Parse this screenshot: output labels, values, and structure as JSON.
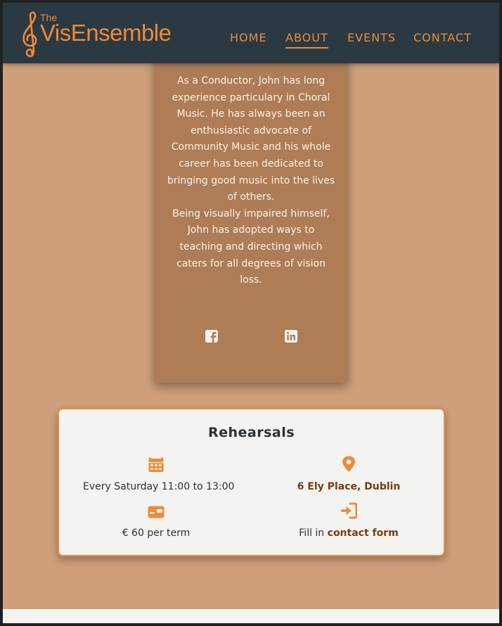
{
  "brand": {
    "the": "The",
    "name_a": "Vis",
    "name_b": "Ensemble",
    "accent_color": "#ee8a3a",
    "icon": "treble-clef-icon"
  },
  "nav": {
    "items": [
      {
        "label": "HOME",
        "active": false
      },
      {
        "label": "ABOUT",
        "active": true
      },
      {
        "label": "EVENTS",
        "active": false
      },
      {
        "label": "CONTACT",
        "active": false
      }
    ]
  },
  "profile": {
    "bio_1": "As a Conductor, John has long experience particulary in Choral Music. He has always been an enthusiastic advocate of Community Music and his whole career has been dedicated to bringing good music into the lives of others.",
    "bio_2": "Being visually impaired himself, John has adopted ways to teaching and directing which caters for all degrees of vision loss.",
    "social": [
      "facebook-icon",
      "linkedin-icon"
    ]
  },
  "rehearsals": {
    "title": "Rehearsals",
    "schedule": "Every Saturday 11:00 to 13:00",
    "location": "6 Ely Place, Dublin",
    "price": "€ 60 per term",
    "signup_prefix": "Fill in ",
    "signup_link": "contact form",
    "icons": [
      "calendar-icon",
      "map-pin-icon",
      "money-card-icon",
      "sign-in-icon"
    ]
  }
}
